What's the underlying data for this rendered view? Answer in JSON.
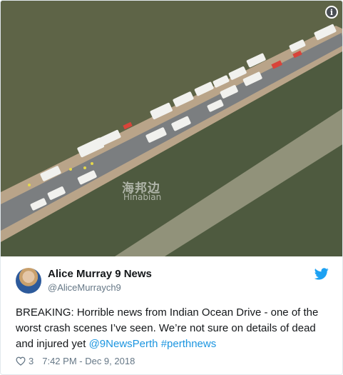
{
  "photo": {
    "info_icon": "info-icon",
    "watermark": {
      "chinese": "海邦边",
      "latin": "Hinabian"
    }
  },
  "tweet": {
    "display_name": "Alice Murray 9 News",
    "handle": "@AliceMurraych9",
    "text_plain": "BREAKING: Horrible news from Indian Ocean Drive - one of the worst crash scenes I’ve seen. We’re not sure on details of dead and injured yet",
    "mention": "@9NewsPerth",
    "hashtag": "#perthnews",
    "like_count": "3",
    "timestamp": "7:42 PM - Dec 9, 2018"
  },
  "colors": {
    "link": "#1b95e0",
    "twitter_blue": "#1da1f2",
    "secondary_text": "#657786"
  },
  "icons": [
    "info-icon",
    "twitter-bird-icon",
    "heart-icon",
    "avatar"
  ]
}
